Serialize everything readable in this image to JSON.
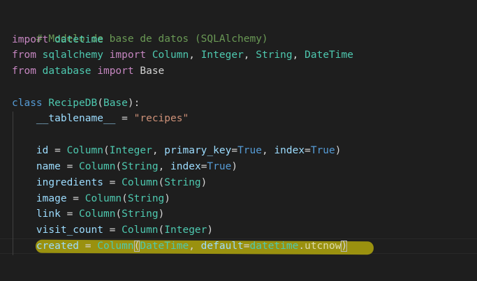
{
  "editor": {
    "colors": {
      "background": "#1e1e1e",
      "comment": "#6a9955",
      "keyword_import": "#c586c0",
      "keyword_def": "#569cd6",
      "class_name": "#4ec9b0",
      "variable": "#9cdcfe",
      "string": "#ce9178",
      "highlight": "#beb20c"
    },
    "lines": {
      "l1": {
        "t1": "# Modelo de base de datos (SQLAlchemy)"
      },
      "l2": {
        "t1": "import",
        "t2": " ",
        "t3": "datetime"
      },
      "l3": {
        "t1": "from",
        "t2": " ",
        "t3": "sqlalchemy",
        "t4": " ",
        "t5": "import",
        "t6": " ",
        "t7": "Column",
        "t8": ", ",
        "t9": "Integer",
        "t10": ", ",
        "t11": "String",
        "t12": ", ",
        "t13": "DateTime"
      },
      "l4": {
        "t1": "from",
        "t2": " ",
        "t3": "database",
        "t4": " ",
        "t5": "import",
        "t6": " ",
        "t7": "Base"
      },
      "l6": {
        "t1": "class",
        "t2": " ",
        "t3": "RecipeDB",
        "t4": "(",
        "t5": "Base",
        "t6": "):"
      },
      "l7": {
        "t1": "    ",
        "t2": "__tablename__",
        "t3": " = ",
        "t4": "\"recipes\""
      },
      "l9": {
        "t1": "    ",
        "t2": "id",
        "t3": " = ",
        "t4": "Column",
        "t5": "(",
        "t6": "Integer",
        "t7": ", ",
        "t8": "primary_key",
        "t9": "=",
        "t10": "True",
        "t11": ", ",
        "t12": "index",
        "t13": "=",
        "t14": "True",
        "t15": ")"
      },
      "l10": {
        "t1": "    ",
        "t2": "name",
        "t3": " = ",
        "t4": "Column",
        "t5": "(",
        "t6": "String",
        "t7": ", ",
        "t8": "index",
        "t9": "=",
        "t10": "True",
        "t11": ")"
      },
      "l11": {
        "t1": "    ",
        "t2": "ingredients",
        "t3": " = ",
        "t4": "Column",
        "t5": "(",
        "t6": "String",
        "t7": ")"
      },
      "l12": {
        "t1": "    ",
        "t2": "image",
        "t3": " = ",
        "t4": "Column",
        "t5": "(",
        "t6": "String",
        "t7": ")"
      },
      "l13": {
        "t1": "    ",
        "t2": "link",
        "t3": " = ",
        "t4": "Column",
        "t5": "(",
        "t6": "String",
        "t7": ")"
      },
      "l14": {
        "t1": "    ",
        "t2": "visit_count",
        "t3": " = ",
        "t4": "Column",
        "t5": "(",
        "t6": "Integer",
        "t7": ")"
      },
      "l15": {
        "t1": "    ",
        "t2": "created",
        "t3": " = ",
        "t4": "Column",
        "t5": "(",
        "t6": "DateTime",
        "t7": ", ",
        "t8": "default",
        "t9": "=",
        "t10": "datetime",
        "t11": ".",
        "t12": "utcnow",
        "t13": ")"
      }
    }
  }
}
